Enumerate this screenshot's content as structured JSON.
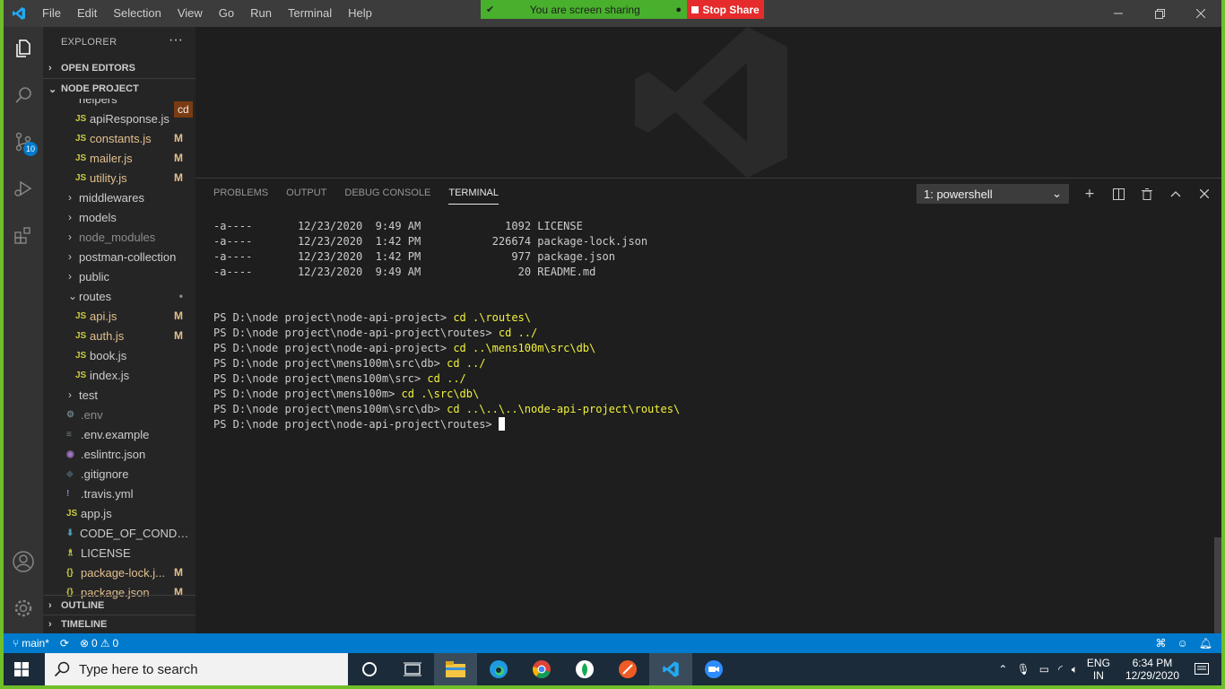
{
  "menu": [
    "File",
    "Edit",
    "Selection",
    "View",
    "Go",
    "Run",
    "Terminal",
    "Help"
  ],
  "share": {
    "message": "You are screen sharing",
    "stop_label": "Stop Share"
  },
  "activity_badge": "10",
  "explorer": {
    "title": "EXPLORER",
    "more": "···",
    "open_editors": "OPEN EDITORS",
    "project": "NODE PROJECT",
    "partial_folder": "helpers",
    "tooltip": "cd",
    "items": [
      {
        "label": "apiResponse.js",
        "status": "",
        "type": "js"
      },
      {
        "label": "constants.js",
        "status": "M",
        "type": "js"
      },
      {
        "label": "mailer.js",
        "status": "M",
        "type": "js"
      },
      {
        "label": "utility.js",
        "status": "M",
        "type": "js"
      },
      {
        "label": "middlewares",
        "status": "",
        "type": "folder"
      },
      {
        "label": "models",
        "status": "",
        "type": "folder"
      },
      {
        "label": "node_modules",
        "status": "",
        "type": "folder-dim"
      },
      {
        "label": "postman-collection",
        "status": "",
        "type": "folder"
      },
      {
        "label": "public",
        "status": "",
        "type": "folder"
      },
      {
        "label": "routes",
        "status": "•",
        "type": "folder-open"
      },
      {
        "label": "api.js",
        "status": "M",
        "type": "js"
      },
      {
        "label": "auth.js",
        "status": "M",
        "type": "js"
      },
      {
        "label": "book.js",
        "status": "",
        "type": "js"
      },
      {
        "label": "index.js",
        "status": "",
        "type": "js"
      },
      {
        "label": "test",
        "status": "",
        "type": "folder"
      },
      {
        "label": ".env",
        "status": "",
        "type": "gear"
      },
      {
        "label": ".env.example",
        "status": "",
        "type": "lines"
      },
      {
        "label": ".eslintrc.json",
        "status": "",
        "type": "eslint"
      },
      {
        "label": ".gitignore",
        "status": "",
        "type": "git"
      },
      {
        "label": ".travis.yml",
        "status": "",
        "type": "yml"
      },
      {
        "label": "app.js",
        "status": "",
        "type": "js-root"
      },
      {
        "label": "CODE_OF_CONDUC...",
        "status": "",
        "type": "md"
      },
      {
        "label": "LICENSE",
        "status": "",
        "type": "license"
      },
      {
        "label": "package-lock.j...",
        "status": "M",
        "type": "json"
      },
      {
        "label": "package.json",
        "status": "M",
        "type": "json"
      }
    ],
    "outline": "OUTLINE",
    "timeline": "TIMELINE"
  },
  "panel": {
    "tabs": [
      "PROBLEMS",
      "OUTPUT",
      "DEBUG CONSOLE",
      "TERMINAL"
    ],
    "active_tab": "TERMINAL",
    "terminal_select": "1: powershell"
  },
  "terminal": {
    "listing": [
      {
        "mode": "-a----",
        "date": "12/23/2020",
        "time": "9:49 AM",
        "length": "1092",
        "name": "LICENSE"
      },
      {
        "mode": "-a----",
        "date": "12/23/2020",
        "time": "1:42 PM",
        "length": "226674",
        "name": "package-lock.json"
      },
      {
        "mode": "-a----",
        "date": "12/23/2020",
        "time": "1:42 PM",
        "length": "977",
        "name": "package.json"
      },
      {
        "mode": "-a----",
        "date": "12/23/2020",
        "time": "9:49 AM",
        "length": "20",
        "name": "README.md"
      }
    ],
    "commands": [
      {
        "prompt": "PS D:\\node project\\node-api-project> ",
        "cmd": "cd .\\routes\\"
      },
      {
        "prompt": "PS D:\\node project\\node-api-project\\routes> ",
        "cmd": "cd ../"
      },
      {
        "prompt": "PS D:\\node project\\node-api-project> ",
        "cmd": "cd ..\\mens100m\\src\\db\\"
      },
      {
        "prompt": "PS D:\\node project\\mens100m\\src\\db> ",
        "cmd": "cd ../"
      },
      {
        "prompt": "PS D:\\node project\\mens100m\\src> ",
        "cmd": "cd ../"
      },
      {
        "prompt": "PS D:\\node project\\mens100m> ",
        "cmd": "cd .\\src\\db\\"
      },
      {
        "prompt": "PS D:\\node project\\mens100m\\src\\db> ",
        "cmd": "cd ..\\..\\..\\node-api-project\\routes\\"
      }
    ],
    "current_prompt": "PS D:\\node project\\node-api-project\\routes> "
  },
  "statusbar": {
    "branch": "main*",
    "errors": "0",
    "warnings": "0"
  },
  "taskbar": {
    "search_placeholder": "Type here to search",
    "lang": "ENG",
    "region": "IN",
    "time": "6:34 PM",
    "date": "12/29/2020"
  },
  "colors": {
    "accent": "#007acc",
    "modified": "#e2c08d",
    "js_icon": "#cbcb41",
    "share_green": "#48b02c",
    "share_red": "#e52b2b"
  }
}
